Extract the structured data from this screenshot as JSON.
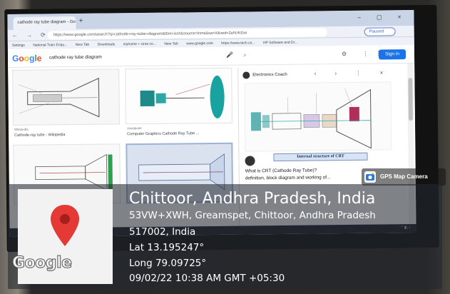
{
  "browser": {
    "tab_title": "cathode ray tube diagram - Go",
    "new_tab_symbol": "+",
    "window_controls": "–  ▢  ×",
    "nav_icons": "←  →  ⟳  ⌂",
    "url": "https://www.google.com/search?q=cathode+ray+tube+diagram&tbm=isch&source=lnms&sa=X&ved=2ahUKEwi",
    "paused_label": "Paused",
    "bookmarks": [
      "Settings",
      "National Train Enqu...",
      "New Tab",
      "Downloads",
      "myhome + cirse co...",
      "New Tab",
      "www.google.com",
      "https://www.tech.co...",
      "HP Software and Dr..."
    ]
  },
  "google": {
    "logo_letters": [
      "G",
      "o",
      "o",
      "g",
      "l",
      "e"
    ],
    "logo_colors": [
      "#4285f4",
      "#ea4335",
      "#fbbc05",
      "#4285f4",
      "#34a853",
      "#ea4335"
    ],
    "query": "cathode ray tube diagram",
    "signin_label": "Sign in",
    "results": [
      {
        "caption": "Cathode-ray tube - Wikipedia",
        "source": "Wikipedia"
      },
      {
        "caption": "Computer Graphics Cathode Ray Tube ...",
        "source": "Javatpoint"
      }
    ],
    "panel": {
      "source": "Electronics Coach",
      "caption": "Internal structure of CRT",
      "question": "What is CRT (Cathode Ray Tube)?",
      "snippet": "definition, block diagram and working of..."
    }
  },
  "gps": {
    "badge": "GPS Map Camera",
    "map_logo": "Google",
    "title": "Chittoor, Andhra Pradesh, India",
    "address_line1": "53VW+XWH, Greamspet, Chittoor, Andhra Pradesh",
    "address_line2": "517002, India",
    "lat": "Lat 13.195247°",
    "long": "Long 79.09725°",
    "datetime": "09/02/22 10:38 AM GMT +05:30"
  }
}
